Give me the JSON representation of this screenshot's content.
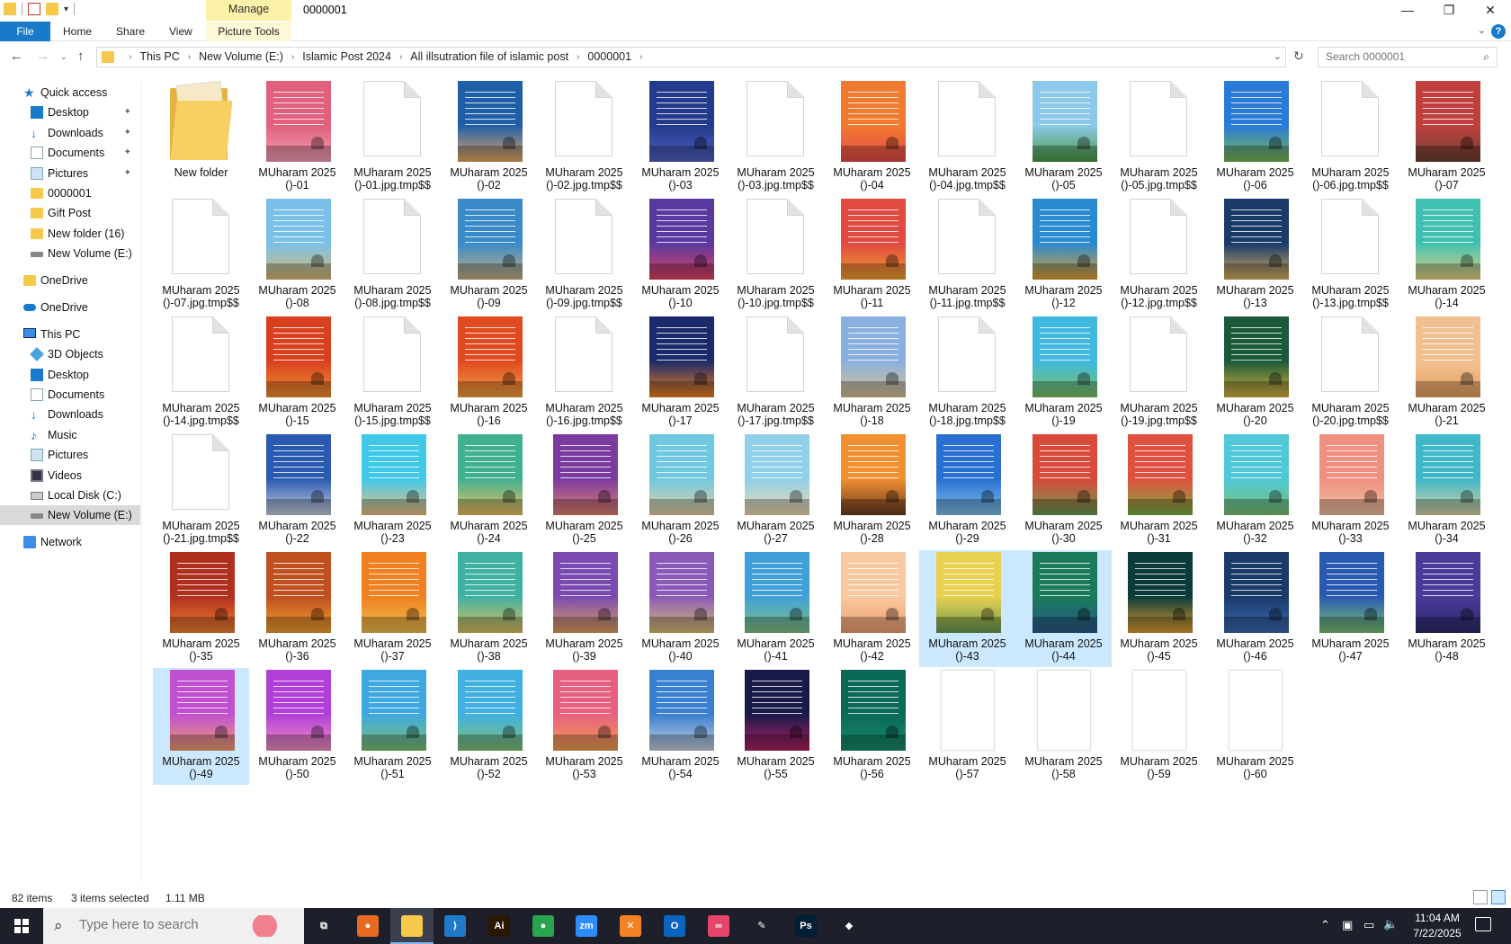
{
  "titlebar": {
    "manage_tab": "Manage",
    "window_title": "0000001",
    "minimize": "—",
    "maximize": "❐",
    "close": "✕"
  },
  "ribbon": {
    "tabs": [
      "File",
      "Home",
      "Share",
      "View",
      "Picture Tools"
    ],
    "help": "?"
  },
  "address": {
    "crumbs": [
      "This PC",
      "New Volume (E:)",
      "Islamic Post 2024",
      "All illsutration file of islamic post",
      "0000001"
    ],
    "search_placeholder": "Search 0000001"
  },
  "nav_pane": [
    {
      "label": "Quick access",
      "icon": "star-icon",
      "pinned": false
    },
    {
      "label": "Desktop",
      "icon": "desktop-icon",
      "pinned": true
    },
    {
      "label": "Downloads",
      "icon": "download-icon",
      "pinned": true
    },
    {
      "label": "Documents",
      "icon": "documents-icon",
      "pinned": true
    },
    {
      "label": "Pictures",
      "icon": "pictures-icon",
      "pinned": true
    },
    {
      "label": "0000001",
      "icon": "folder-icon",
      "pinned": false
    },
    {
      "label": "Gift Post",
      "icon": "folder-icon",
      "pinned": false
    },
    {
      "label": "New folder (16)",
      "icon": "folder-icon",
      "pinned": false
    },
    {
      "label": "New Volume (E:)",
      "icon": "drive-icon",
      "pinned": false
    },
    {
      "label": "OneDrive",
      "icon": "folder-icon",
      "pinned": false
    },
    {
      "label": "OneDrive",
      "icon": "cloud-icon",
      "pinned": false
    },
    {
      "label": "This PC",
      "icon": "computer-icon",
      "pinned": false
    },
    {
      "label": "3D Objects",
      "icon": "cube-icon",
      "pinned": false
    },
    {
      "label": "Desktop",
      "icon": "desktop-icon",
      "pinned": false
    },
    {
      "label": "Documents",
      "icon": "documents-icon",
      "pinned": false
    },
    {
      "label": "Downloads",
      "icon": "download-icon",
      "pinned": false
    },
    {
      "label": "Music",
      "icon": "music-icon",
      "pinned": false
    },
    {
      "label": "Pictures",
      "icon": "pictures-icon",
      "pinned": false
    },
    {
      "label": "Videos",
      "icon": "video-icon",
      "pinned": false
    },
    {
      "label": "Local Disk (C:)",
      "icon": "disk-icon",
      "pinned": false
    },
    {
      "label": "New Volume (E:)",
      "icon": "drive-icon",
      "pinned": false,
      "selected": true
    },
    {
      "label": "Network",
      "icon": "network-icon",
      "pinned": false
    }
  ],
  "files": [
    {
      "l1": "New folder",
      "l2": "",
      "kind": "folder"
    },
    {
      "l1": "MUharam 2025",
      "l2": "()-01",
      "kind": "img",
      "color": "#e0607e",
      "color2": "#f5a0b5"
    },
    {
      "l1": "MUharam 2025",
      "l2": "()-01.jpg.tmp$$",
      "kind": "blank"
    },
    {
      "l1": "MUharam 2025",
      "l2": "()-02",
      "kind": "img",
      "color": "#1f5fa8",
      "color2": "#e8a860"
    },
    {
      "l1": "MUharam 2025",
      "l2": "()-02.jpg.tmp$$",
      "kind": "blank"
    },
    {
      "l1": "MUharam 2025",
      "l2": "()-03",
      "kind": "img",
      "color": "#243a8c",
      "color2": "#5060c0"
    },
    {
      "l1": "MUharam 2025",
      "l2": "()-03.jpg.tmp$$",
      "kind": "blank"
    },
    {
      "l1": "MUharam 2025",
      "l2": "()-04",
      "kind": "img",
      "color": "#f07a30",
      "color2": "#e84a4a"
    },
    {
      "l1": "MUharam 2025",
      "l2": "()-04.jpg.tmp$$",
      "kind": "blank"
    },
    {
      "l1": "MUharam 2025",
      "l2": "()-05",
      "kind": "img",
      "color": "#8cc8e8",
      "color2": "#4a9a40"
    },
    {
      "l1": "MUharam 2025",
      "l2": "()-05.jpg.tmp$$",
      "kind": "blank"
    },
    {
      "l1": "MUharam 2025",
      "l2": "()-06",
      "kind": "img",
      "color": "#2a7ad8",
      "color2": "#7ab850"
    },
    {
      "l1": "MUharam 2025",
      "l2": "()-06.jpg.tmp$$",
      "kind": "blank"
    },
    {
      "l1": "MUharam 2025",
      "l2": "()-07",
      "kind": "img",
      "color": "#c04040",
      "color2": "#6a4030"
    },
    {
      "l1": "MUharam 2025",
      "l2": "()-07.jpg.tmp$$",
      "kind": "blank"
    },
    {
      "l1": "MUharam 2025",
      "l2": "()-08",
      "kind": "img",
      "color": "#7ac0e8",
      "color2": "#d8b870"
    },
    {
      "l1": "MUharam 2025",
      "l2": "()-08.jpg.tmp$$",
      "kind": "blank"
    },
    {
      "l1": "MUharam 2025",
      "l2": "()-09",
      "kind": "img",
      "color": "#3a8ac8",
      "color2": "#c8b080"
    },
    {
      "l1": "MUharam 2025",
      "l2": "()-09.jpg.tmp$$",
      "kind": "blank"
    },
    {
      "l1": "MUharam 2025",
      "l2": "()-10",
      "kind": "img",
      "color": "#5a3aa0",
      "color2": "#e04060"
    },
    {
      "l1": "MUharam 2025",
      "l2": "()-10.jpg.tmp$$",
      "kind": "blank"
    },
    {
      "l1": "MUharam 2025",
      "l2": "()-11",
      "kind": "img",
      "color": "#e04a40",
      "color2": "#f0a030"
    },
    {
      "l1": "MUharam 2025",
      "l2": "()-11.jpg.tmp$$",
      "kind": "blank"
    },
    {
      "l1": "MUharam 2025",
      "l2": "()-12",
      "kind": "img",
      "color": "#2a8ad0",
      "color2": "#e0a030"
    },
    {
      "l1": "MUharam 2025",
      "l2": "()-12.jpg.tmp$$",
      "kind": "blank"
    },
    {
      "l1": "MUharam 2025",
      "l2": "()-13",
      "kind": "img",
      "color": "#1a3a6a",
      "color2": "#d8b060"
    },
    {
      "l1": "MUharam 2025",
      "l2": "()-13.jpg.tmp$$",
      "kind": "blank"
    },
    {
      "l1": "MUharam 2025",
      "l2": "()-14",
      "kind": "img",
      "color": "#40c0b0",
      "color2": "#e8d080"
    },
    {
      "l1": "MUharam 2025",
      "l2": "()-14.jpg.tmp$$",
      "kind": "blank"
    },
    {
      "l1": "MUharam 2025",
      "l2": "()-15",
      "kind": "img",
      "color": "#d84020",
      "color2": "#f09030"
    },
    {
      "l1": "MUharam 2025",
      "l2": "()-15.jpg.tmp$$",
      "kind": "blank"
    },
    {
      "l1": "MUharam 2025",
      "l2": "()-16",
      "kind": "img",
      "color": "#e04a20",
      "color2": "#f0a040"
    },
    {
      "l1": "MUharam 2025",
      "l2": "()-16.jpg.tmp$$",
      "kind": "blank"
    },
    {
      "l1": "MUharam 2025",
      "l2": "()-17",
      "kind": "img",
      "color": "#1a2a6a",
      "color2": "#f08020"
    },
    {
      "l1": "MUharam 2025",
      "l2": "()-17.jpg.tmp$$",
      "kind": "blank"
    },
    {
      "l1": "MUharam 2025",
      "l2": "()-18",
      "kind": "img",
      "color": "#8ab0e0",
      "color2": "#d8c090"
    },
    {
      "l1": "MUharam 2025",
      "l2": "()-18.jpg.tmp$$",
      "kind": "blank"
    },
    {
      "l1": "MUharam 2025",
      "l2": "()-19",
      "kind": "img",
      "color": "#40b8e0",
      "color2": "#7ac060"
    },
    {
      "l1": "MUharam 2025",
      "l2": "()-19.jpg.tmp$$",
      "kind": "blank"
    },
    {
      "l1": "MUharam 2025",
      "l2": "()-20",
      "kind": "img",
      "color": "#1a5a3a",
      "color2": "#d8b040"
    },
    {
      "l1": "MUharam 2025",
      "l2": "()-20.jpg.tmp$$",
      "kind": "blank"
    },
    {
      "l1": "MUharam 2025",
      "l2": "()-21",
      "kind": "img",
      "color": "#f0c090",
      "color2": "#e8a060"
    },
    {
      "l1": "MUharam 2025",
      "l2": "()-21.jpg.tmp$$",
      "kind": "blank"
    },
    {
      "l1": "MUharam 2025",
      "l2": "()-22",
      "kind": "img",
      "color": "#2a5ab0",
      "color2": "#c8d0e0"
    },
    {
      "l1": "MUharam 2025",
      "l2": "()-23",
      "kind": "img",
      "color": "#40c8e8",
      "color2": "#f0c080"
    },
    {
      "l1": "MUharam 2025",
      "l2": "()-24",
      "kind": "img",
      "color": "#40b090",
      "color2": "#f0c060"
    },
    {
      "l1": "MUharam 2025",
      "l2": "()-25",
      "kind": "img",
      "color": "#7a3aa0",
      "color2": "#e08070"
    },
    {
      "l1": "MUharam 2025",
      "l2": "()-26",
      "kind": "img",
      "color": "#70c8e0",
      "color2": "#e8d0a0"
    },
    {
      "l1": "MUharam 2025",
      "l2": "()-27",
      "kind": "img",
      "color": "#90d0e8",
      "color2": "#f0d8b0"
    },
    {
      "l1": "MUharam 2025",
      "l2": "()-28",
      "kind": "img",
      "color": "#f09030",
      "color2": "#6a3a20"
    },
    {
      "l1": "MUharam 2025",
      "l2": "()-29",
      "kind": "img",
      "color": "#2a70d0",
      "color2": "#80c0e8"
    },
    {
      "l1": "MUharam 2025",
      "l2": "()-30",
      "kind": "img",
      "color": "#d84a3a",
      "color2": "#6a9a50"
    },
    {
      "l1": "MUharam 2025",
      "l2": "()-31",
      "kind": "img",
      "color": "#e05040",
      "color2": "#7ab040"
    },
    {
      "l1": "MUharam 2025",
      "l2": "()-32",
      "kind": "img",
      "color": "#50c8d8",
      "color2": "#7ac070"
    },
    {
      "l1": "MUharam 2025",
      "l2": "()-33",
      "kind": "img",
      "color": "#f09080",
      "color2": "#f0c0a0"
    },
    {
      "l1": "MUharam 2025",
      "l2": "()-34",
      "kind": "img",
      "color": "#40b8c8",
      "color2": "#d8d0a0"
    },
    {
      "l1": "MUharam 2025",
      "l2": "()-35",
      "kind": "img",
      "color": "#b03020",
      "color2": "#f08030"
    },
    {
      "l1": "MUharam 2025",
      "l2": "()-36",
      "kind": "img",
      "color": "#c05020",
      "color2": "#f0a030"
    },
    {
      "l1": "MUharam 2025",
      "l2": "()-37",
      "kind": "img",
      "color": "#f08020",
      "color2": "#f0c050"
    },
    {
      "l1": "MUharam 2025",
      "l2": "()-38",
      "kind": "img",
      "color": "#40b0a0",
      "color2": "#e0c060"
    },
    {
      "l1": "MUharam 2025",
      "l2": "()-39",
      "kind": "img",
      "color": "#7a4ab0",
      "color2": "#e0a060"
    },
    {
      "l1": "MUharam 2025",
      "l2": "()-40",
      "kind": "img",
      "color": "#8a5ab8",
      "color2": "#d8c070"
    },
    {
      "l1": "MUharam 2025",
      "l2": "()-41",
      "kind": "img",
      "color": "#40a0d8",
      "color2": "#80c080"
    },
    {
      "l1": "MUharam 2025",
      "l2": "()-42",
      "kind": "img",
      "color": "#f8c8a0",
      "color2": "#f0a070"
    },
    {
      "l1": "MUharam 2025",
      "l2": "()-43",
      "kind": "img",
      "color": "#e8d050",
      "color2": "#6a9a50",
      "selected": true
    },
    {
      "l1": "MUharam 2025",
      "l2": "()-44",
      "kind": "img",
      "color": "#1a7a5a",
      "color2": "#2a5a8a",
      "selected": true
    },
    {
      "l1": "MUharam 2025",
      "l2": "()-45",
      "kind": "img",
      "color": "#0a3a3a",
      "color2": "#e0a030"
    },
    {
      "l1": "MUharam 2025",
      "l2": "()-46",
      "kind": "img",
      "color": "#1a3a6a",
      "color2": "#3a6ab0"
    },
    {
      "l1": "MUharam 2025",
      "l2": "()-47",
      "kind": "img",
      "color": "#2a5ab0",
      "color2": "#7ac070"
    },
    {
      "l1": "MUharam 2025",
      "l2": "()-48",
      "kind": "img",
      "color": "#4a3a9a",
      "color2": "#2a2a6a"
    },
    {
      "l1": "MUharam 2025",
      "l2": "()-49",
      "kind": "img",
      "color": "#c050d0",
      "color2": "#f0a070",
      "selected": true
    },
    {
      "l1": "MUharam 2025",
      "l2": "()-50",
      "kind": "img",
      "color": "#b040d8",
      "color2": "#f090c0"
    },
    {
      "l1": "MUharam 2025",
      "l2": "()-51",
      "kind": "img",
      "color": "#40a8e0",
      "color2": "#7ac070"
    },
    {
      "l1": "MUharam 2025",
      "l2": "()-52",
      "kind": "img",
      "color": "#40b0e0",
      "color2": "#80c070"
    },
    {
      "l1": "MUharam 2025",
      "l2": "()-53",
      "kind": "img",
      "color": "#e86080",
      "color2": "#f0a050"
    },
    {
      "l1": "MUharam 2025",
      "l2": "()-54",
      "kind": "img",
      "color": "#3a80d0",
      "color2": "#c8d0e0"
    },
    {
      "l1": "MUharam 2025",
      "l2": "()-55",
      "kind": "img",
      "color": "#1a1a4a",
      "color2": "#b02060"
    },
    {
      "l1": "MUharam 2025",
      "l2": "()-56",
      "kind": "img",
      "color": "#0a6a5a",
      "color2": "#1a8a6a"
    },
    {
      "l1": "MUharam 2025",
      "l2": "()-57",
      "kind": "white"
    },
    {
      "l1": "MUharam 2025",
      "l2": "()-58",
      "kind": "white"
    },
    {
      "l1": "MUharam 2025",
      "l2": "()-59",
      "kind": "white"
    },
    {
      "l1": "MUharam 2025",
      "l2": "()-60",
      "kind": "white"
    }
  ],
  "status": {
    "item_count": "82 items",
    "selection": "3 items selected",
    "size": "1.11 MB"
  },
  "taskbar": {
    "search_placeholder": "Type here to search",
    "time": "11:04 AM",
    "date": "7/22/2025",
    "apps": [
      {
        "name": "task-view-icon",
        "glyph": "⧉",
        "color": "transparent"
      },
      {
        "name": "firefox-icon",
        "glyph": "●",
        "color": "#e86a20"
      },
      {
        "name": "file-explorer-icon",
        "glyph": "",
        "color": "#f6c94a",
        "active": true
      },
      {
        "name": "vscode-icon",
        "glyph": "⟩",
        "color": "#1f7acc"
      },
      {
        "name": "illustrator-icon",
        "glyph": "Ai",
        "color": "#2b1600"
      },
      {
        "name": "chrome-icon",
        "glyph": "●",
        "color": "#2aa44f"
      },
      {
        "name": "zoom-icon",
        "glyph": "zm",
        "color": "#2d8cff"
      },
      {
        "name": "xampp-icon",
        "glyph": "✕",
        "color": "#f48124"
      },
      {
        "name": "outlook-icon",
        "glyph": "O",
        "color": "#0a64c0"
      },
      {
        "name": "creative-cloud-icon",
        "glyph": "∞",
        "color": "#e6456a"
      },
      {
        "name": "pen-tool-icon",
        "glyph": "✎",
        "color": "transparent"
      },
      {
        "name": "photoshop-icon",
        "glyph": "Ps",
        "color": "#001e36"
      },
      {
        "name": "app-diamond-icon",
        "glyph": "◆",
        "color": "transparent"
      }
    ]
  }
}
